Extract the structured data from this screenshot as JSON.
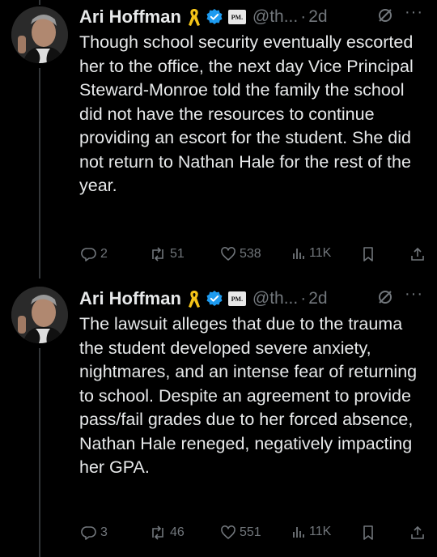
{
  "tweets": [
    {
      "author_name": "Ari Hoffman",
      "handle": "@th...",
      "separator": "·",
      "time": "2d",
      "affiliate_badge": "PM.",
      "body": "Though school security eventually escorted her to the office, the next day Vice Principal Steward-Monroe told the family the school did not have the resources to continue providing an escort for the student. She did not return to Nathan Hale for the rest of the year.",
      "replies": "2",
      "retweets": "51",
      "likes": "538",
      "views": "11K"
    },
    {
      "author_name": "Ari Hoffman",
      "handle": "@th...",
      "separator": "·",
      "time": "2d",
      "affiliate_badge": "PM.",
      "body": "The lawsuit alleges that due to the trauma the student developed severe anxiety, nightmares, and an intense fear of returning to school. Despite an agreement to provide pass/fail grades due to her forced absence, Nathan Hale reneged, negatively impacting her GPA.",
      "replies": "3",
      "retweets": "46",
      "likes": "551",
      "views": "11K"
    }
  ],
  "more_label": "···",
  "colors": {
    "background": "#000000",
    "text": "#e7e9ea",
    "muted": "#71767b",
    "verified": "#1d9bf0",
    "ribbon": "#f5c518"
  }
}
